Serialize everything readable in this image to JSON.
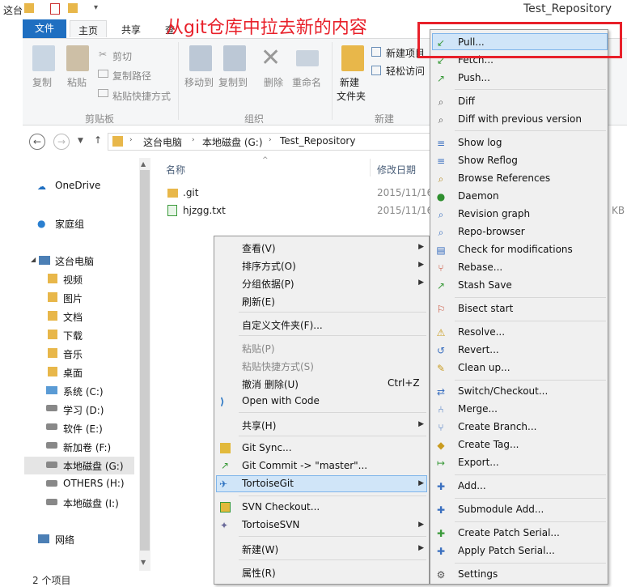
{
  "window": {
    "title_left": "这台",
    "title": "Test_Repository"
  },
  "annotation": "从git仓库中拉去新的内容",
  "ribbon_tabs": {
    "file": "文件",
    "home": "主页",
    "share": "共享",
    "view": "查"
  },
  "ribbon": {
    "copy": "复制",
    "paste": "粘贴",
    "cut": "剪切",
    "copy_path": "复制路径",
    "paste_shortcut": "粘贴快捷方式",
    "move_to": "移动到",
    "copy_to": "复制到",
    "delete": "删除",
    "rename": "重命名",
    "new_folder": "新建\n文件夹",
    "new_folder_line1": "新建",
    "new_folder_line2": "文件夹",
    "new_item": "新建项目",
    "easy_access": "轻松访问",
    "group_clipboard": "剪贴板",
    "group_organize": "组织",
    "group_new": "新建"
  },
  "address": {
    "parts": [
      "这台电脑",
      "本地磁盘 (G:)",
      "Test_Repository"
    ]
  },
  "columns": {
    "name": "名称",
    "date": "修改日期"
  },
  "files": [
    {
      "name": ".git",
      "date": "2015/11/16"
    },
    {
      "name": "hjzgg.txt",
      "date": "2015/11/16",
      "size": "KB"
    }
  ],
  "nav": {
    "onedrive": "OneDrive",
    "homegroup": "家庭组",
    "thispc": "这台电脑",
    "videos": "视频",
    "pictures": "图片",
    "docs": "文档",
    "downloads": "下载",
    "music": "音乐",
    "desktop": "桌面",
    "drive_c": "系统 (C:)",
    "drive_d": "学习 (D:)",
    "drive_e": "软件 (E:)",
    "drive_f": "新加卷 (F:)",
    "drive_g": "本地磁盘 (G:)",
    "drive_h": "OTHERS (H:)",
    "drive_i": "本地磁盘 (I:)",
    "network": "网络"
  },
  "status": "2 个项目",
  "context_menu": {
    "view": "查看(V)",
    "sort": "排序方式(O)",
    "group": "分组依据(P)",
    "refresh": "刷新(E)",
    "customize": "自定义文件夹(F)...",
    "paste": "粘贴(P)",
    "paste_shortcut": "粘贴快捷方式(S)",
    "undo": "撤消 删除(U)",
    "undo_key": "Ctrl+Z",
    "open_code": "Open with Code",
    "share": "共享(H)",
    "git_sync": "Git Sync...",
    "git_commit": "Git Commit -> \"master\"...",
    "tortoisegit": "TortoiseGit",
    "svn_checkout": "SVN Checkout...",
    "tortoisesvn": "TortoiseSVN",
    "new": "新建(W)",
    "properties": "属性(R)"
  },
  "submenu": {
    "pull": "Pull...",
    "fetch": "Fetch...",
    "push": "Push...",
    "diff": "Diff",
    "diff_prev": "Diff with previous version",
    "show_log": "Show log",
    "show_reflog": "Show Reflog",
    "browse_refs": "Browse References",
    "daemon": "Daemon",
    "rev_graph": "Revision graph",
    "repo_browser": "Repo-browser",
    "check_mod": "Check for modifications",
    "rebase": "Rebase...",
    "stash": "Stash Save",
    "bisect": "Bisect start",
    "resolve": "Resolve...",
    "revert": "Revert...",
    "cleanup": "Clean up...",
    "switch": "Switch/Checkout...",
    "merge": "Merge...",
    "branch": "Create Branch...",
    "tag": "Create Tag...",
    "export": "Export...",
    "add": "Add...",
    "submodule": "Submodule Add...",
    "patch_serial": "Create Patch Serial...",
    "apply_patch": "Apply Patch Serial...",
    "settings": "Settings"
  },
  "colors": {
    "accent": "#1f6fc1",
    "highlight": "#d0e5f8",
    "annotation_red": "#e8202a"
  }
}
